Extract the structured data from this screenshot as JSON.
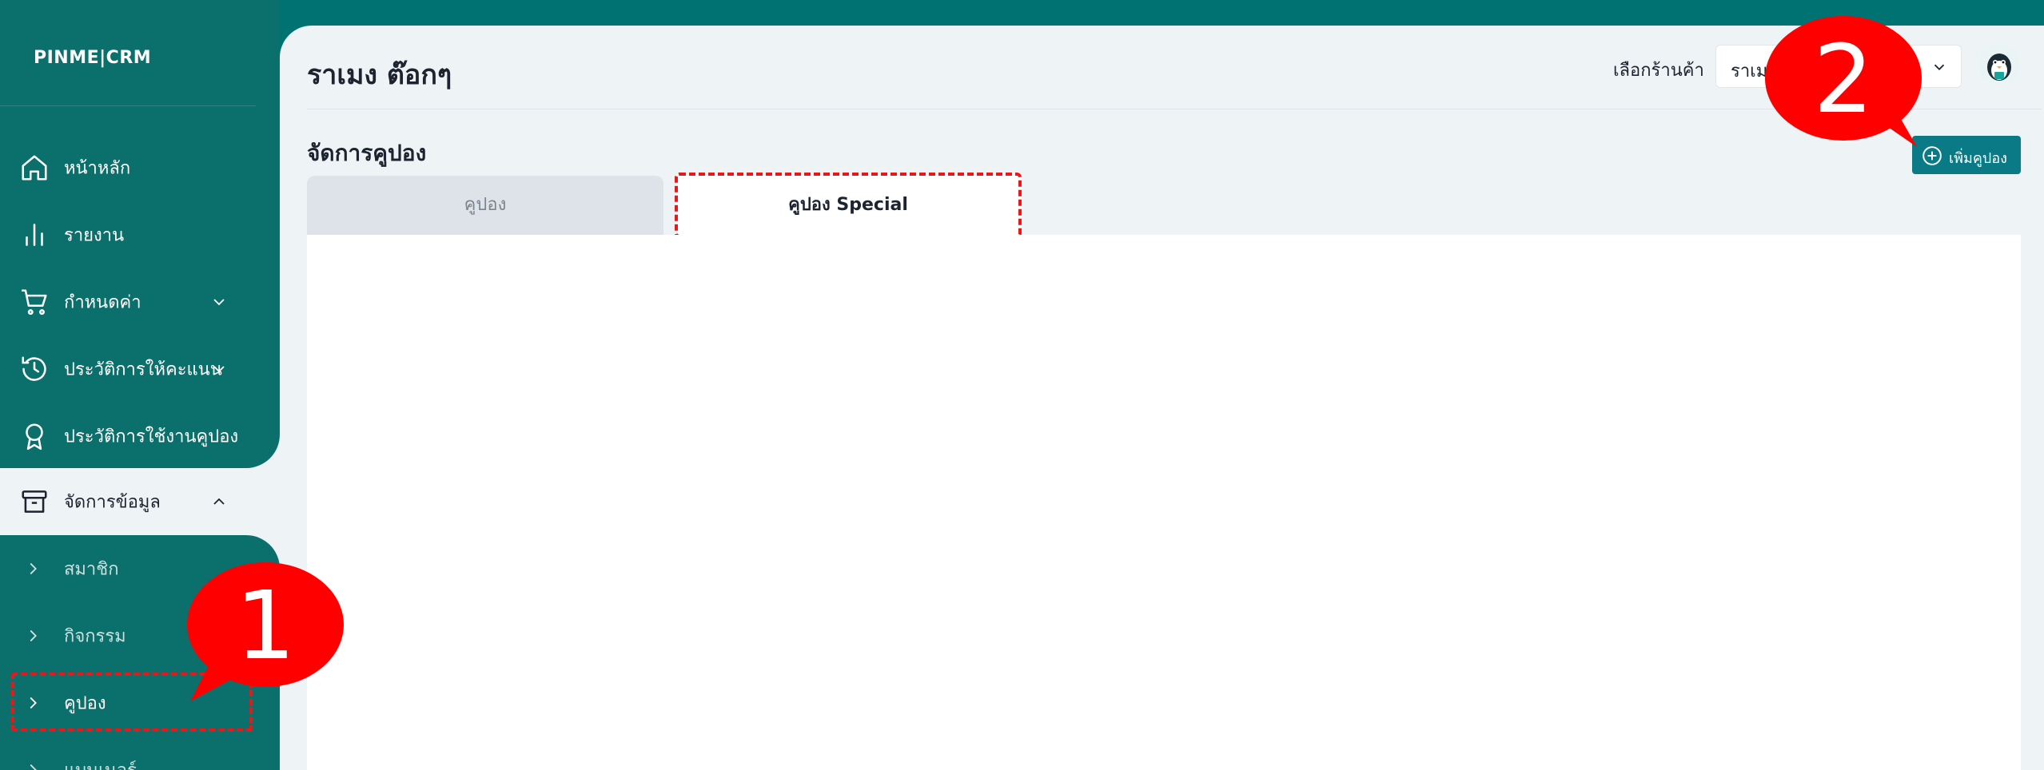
{
  "app": {
    "logo": "PINME|CRM"
  },
  "sidebar": {
    "items": [
      {
        "label": "หน้าหลัก",
        "icon": "home-icon"
      },
      {
        "label": "รายงาน",
        "icon": "bar-chart-icon"
      },
      {
        "label": "กำหนดค่า",
        "icon": "cart-icon"
      },
      {
        "label": "ประวัติการให้คะแนน",
        "icon": "history-icon"
      },
      {
        "label": "ประวัติการใช้งานคูปอง",
        "icon": "award-icon"
      },
      {
        "label": "จัดการข้อมูล",
        "icon": "archive-icon"
      }
    ],
    "subitems": [
      {
        "label": "สมาชิก"
      },
      {
        "label": "กิจกรรม"
      },
      {
        "label": "คูปอง"
      },
      {
        "label": "แบนเนอร์"
      }
    ]
  },
  "header": {
    "title": "ราเมง ต๊อกๆ",
    "store_label": "เลือกร้านค้า",
    "store_value": "ราเมง"
  },
  "section": {
    "title": "จัดการคูปอง",
    "add_button": "เพิ่มคูปอง"
  },
  "tabs": [
    {
      "label": "คูปอง"
    },
    {
      "label": "คูปอง Special"
    }
  ],
  "callouts": [
    {
      "number": "1"
    },
    {
      "number": "2"
    }
  ],
  "colors": {
    "sidebar": "#0b6f6c",
    "background": "#007272",
    "panel": "#eef3f6",
    "accent_button": "#0a7b86",
    "callout_red": "#e6181a"
  }
}
